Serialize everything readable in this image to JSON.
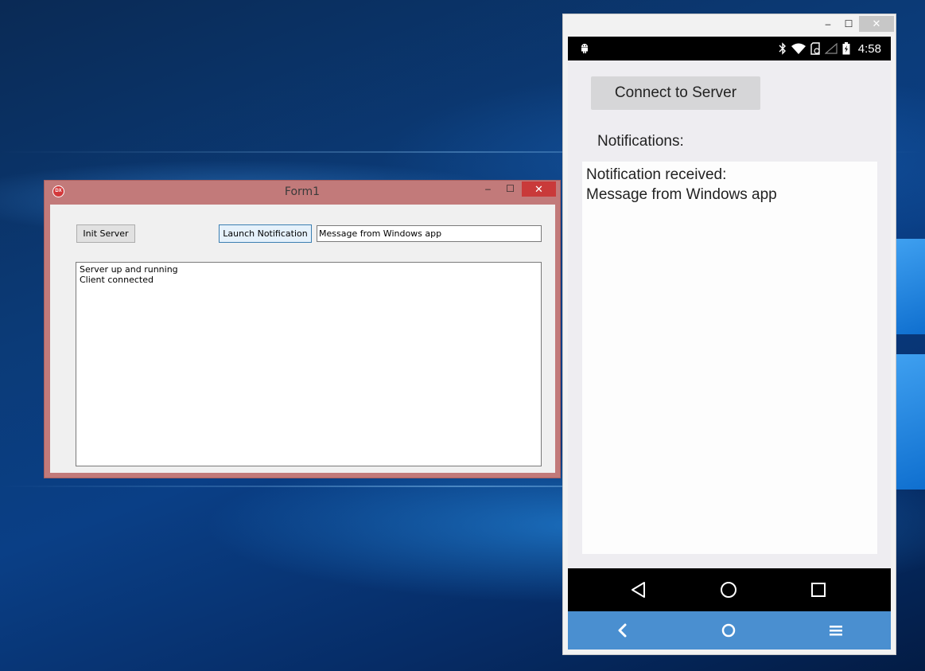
{
  "desktop": {
    "accent": "#0b3b78"
  },
  "form": {
    "title": "Form1",
    "app_icon_text": "DX",
    "controls": {
      "minimize": "–",
      "maximize": "☐",
      "close": "✕"
    },
    "init_server_label": "Init Server",
    "launch_notification_label": "Launch Notification",
    "message_value": "Message from Windows app",
    "log_lines": [
      "Server up and running",
      "Client connected"
    ],
    "titlebar_color": "#c27a7a",
    "close_color": "#c93a3a"
  },
  "emulator": {
    "controls": {
      "minimize": "–",
      "maximize": "☐",
      "close": "✕"
    },
    "status_bar": {
      "time": "4:58",
      "icons": [
        "android-debug-icon",
        "bluetooth-icon",
        "wifi-icon",
        "sd-card-icon",
        "signal-icon",
        "battery-icon"
      ]
    },
    "app": {
      "connect_button_label": "Connect to Server",
      "notifications_label": "Notifications:",
      "notification_lines": [
        "Notification received:",
        "Message from Windows app"
      ]
    },
    "nav_bar": [
      "back-icon",
      "home-icon",
      "recents-icon"
    ],
    "host_bar": {
      "buttons": [
        "back-icon",
        "home-icon",
        "menu-icon"
      ],
      "color": "#4a8fd0"
    }
  }
}
